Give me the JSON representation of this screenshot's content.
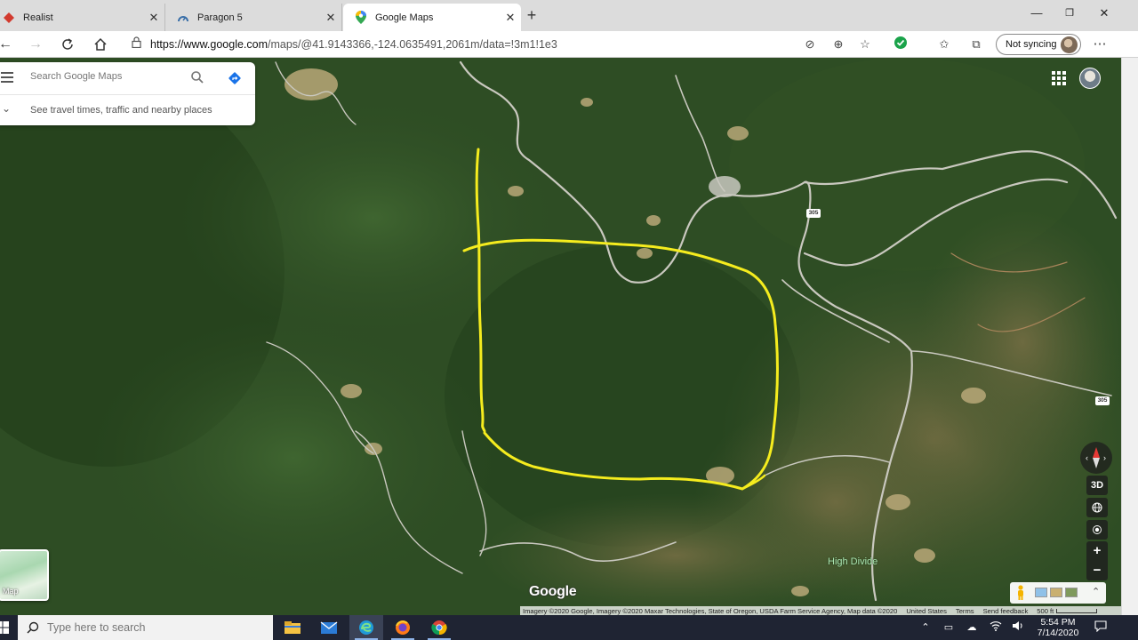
{
  "browser": {
    "tabs": [
      {
        "title": "Realist",
        "icon": "realist-favicon",
        "active": false
      },
      {
        "title": "Paragon 5",
        "icon": "paragon-favicon",
        "active": false
      },
      {
        "title": "Google Maps",
        "icon": "google-maps-favicon",
        "active": true
      }
    ],
    "new_tab_glyph": "+",
    "url_host": "https://www.google.com",
    "url_path": "/maps/@41.9143366,-124.0635491,2061m/data=!3m1!1e3",
    "sync_label": "Not syncing",
    "window_controls": {
      "minimize": "—",
      "restore": "❐",
      "close": "✕"
    }
  },
  "maps": {
    "search": {
      "placeholder": "Search Google Maps"
    },
    "travel_hint": "See travel times, traffic and nearby places",
    "place_label": "High Divide",
    "road_shields": [
      "305",
      "305"
    ],
    "google_logo": "Google",
    "layer_toggle_label": "Map",
    "controls": {
      "tilt": "3D",
      "zoom_in": "+",
      "zoom_out": "−"
    },
    "attribution": {
      "imagery": "Imagery ©2020 Google, Imagery ©2020 Maxar Technologies, State of Oregon, USDA Farm Service Agency, Map data ©2020",
      "region": "United States",
      "terms": "Terms",
      "feedback": "Send feedback",
      "scale": "500 ft"
    },
    "annotation_color": "#f5ec1e"
  },
  "taskbar": {
    "search_placeholder": "Type here to search",
    "apps": [
      "file-explorer-icon",
      "mail-icon",
      "edge-icon",
      "firefox-icon",
      "chrome-icon"
    ],
    "time": "5:54 PM",
    "date": "7/14/2020"
  },
  "colors": {
    "forest": "#2e4d24",
    "forest_dark": "#203a18",
    "clearing": "#8a7a52",
    "road": "#c9c8bf"
  }
}
